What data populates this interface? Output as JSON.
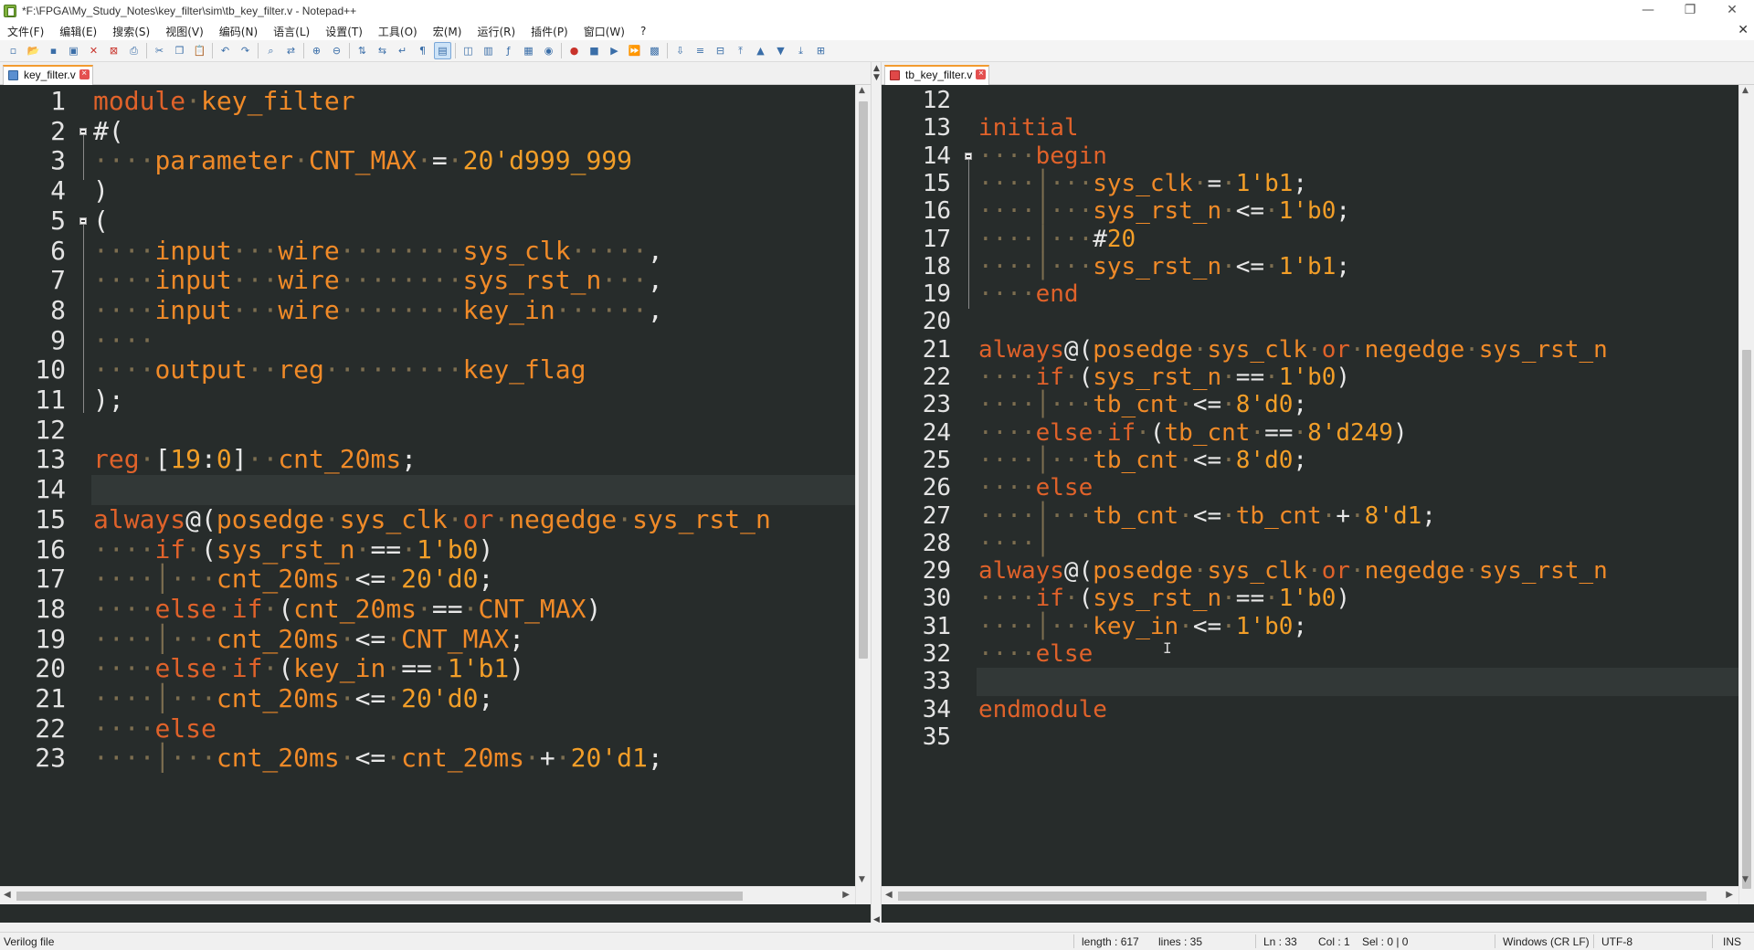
{
  "window": {
    "title": "*F:\\FPGA\\My_Study_Notes\\key_filter\\sim\\tb_key_filter.v - Notepad++",
    "minimize": "—",
    "restore": "❐",
    "close": "✕"
  },
  "menu": [
    "文件(F)",
    "编辑(E)",
    "搜索(S)",
    "视图(V)",
    "编码(N)",
    "语言(L)",
    "设置(T)",
    "工具(O)",
    "宏(M)",
    "运行(R)",
    "插件(P)",
    "窗口(W)",
    "?"
  ],
  "menu_close": "✕",
  "toolbar_icons": [
    "new-file-icon",
    "open-file-icon",
    "save-icon",
    "save-all-icon",
    "close-icon",
    "close-all-icon",
    "print-icon",
    "sep",
    "cut-icon",
    "copy-icon",
    "paste-icon",
    "sep",
    "undo-icon",
    "redo-icon",
    "sep",
    "find-icon",
    "replace-icon",
    "sep",
    "zoom-in-icon",
    "zoom-out-icon",
    "sep",
    "sync-vertical-icon",
    "sync-horizontal-icon",
    "word-wrap-icon",
    "show-all-chars-icon",
    "indent-guide-icon",
    "sep",
    "udl-icon",
    "doc-map-icon",
    "function-list-icon",
    "folder-as-workspace-icon",
    "monitoring-icon",
    "sep",
    "record-macro-icon",
    "stop-record-icon",
    "play-macro-icon",
    "run-macro-multiple-icon",
    "save-macro-icon",
    "sep",
    "compare-icon",
    "diff-icon",
    "prev-diff-icon",
    "first-diff-icon",
    "prev-icon",
    "next-icon",
    "last-icon",
    "plugin-icon"
  ],
  "left_tab": {
    "label": "key_filter.v"
  },
  "right_tab": {
    "label": "tb_key_filter.v"
  },
  "left_lines": [
    {
      "n": "1",
      "t": [
        [
          "kw",
          "module"
        ],
        [
          "ws",
          "·"
        ],
        [
          "id",
          "key_filter"
        ]
      ]
    },
    {
      "n": "2",
      "fold": true,
      "t": [
        [
          "pl",
          "#("
        ]
      ]
    },
    {
      "n": "3",
      "t": [
        [
          "ws",
          "····"
        ],
        [
          "id",
          "parameter"
        ],
        [
          "ws",
          "·"
        ],
        [
          "id",
          "CNT_MAX"
        ],
        [
          "ws",
          "·"
        ],
        [
          "pl",
          "="
        ],
        [
          "ws",
          "·"
        ],
        [
          "num",
          "20'd999_999"
        ]
      ]
    },
    {
      "n": "4",
      "t": [
        [
          "pl",
          ")"
        ]
      ]
    },
    {
      "n": "5",
      "fold": true,
      "t": [
        [
          "pl",
          "("
        ]
      ]
    },
    {
      "n": "6",
      "t": [
        [
          "ws",
          "····"
        ],
        [
          "id",
          "input"
        ],
        [
          "ws",
          "···"
        ],
        [
          "id",
          "wire"
        ],
        [
          "ws",
          "········"
        ],
        [
          "id",
          "sys_clk"
        ],
        [
          "ws",
          "·····"
        ],
        [
          "pl",
          ","
        ]
      ]
    },
    {
      "n": "7",
      "t": [
        [
          "ws",
          "····"
        ],
        [
          "id",
          "input"
        ],
        [
          "ws",
          "···"
        ],
        [
          "id",
          "wire"
        ],
        [
          "ws",
          "········"
        ],
        [
          "id",
          "sys_rst_n"
        ],
        [
          "ws",
          "···"
        ],
        [
          "pl",
          ","
        ]
      ]
    },
    {
      "n": "8",
      "t": [
        [
          "ws",
          "····"
        ],
        [
          "id",
          "input"
        ],
        [
          "ws",
          "···"
        ],
        [
          "id",
          "wire"
        ],
        [
          "ws",
          "········"
        ],
        [
          "id",
          "key_in"
        ],
        [
          "ws",
          "······"
        ],
        [
          "pl",
          ","
        ]
      ]
    },
    {
      "n": "9",
      "t": [
        [
          "ws",
          "····"
        ]
      ]
    },
    {
      "n": "10",
      "t": [
        [
          "ws",
          "····"
        ],
        [
          "id",
          "output"
        ],
        [
          "ws",
          "··"
        ],
        [
          "id",
          "reg"
        ],
        [
          "ws",
          "·········"
        ],
        [
          "id",
          "key_flag"
        ]
      ]
    },
    {
      "n": "11",
      "t": [
        [
          "pl",
          ");"
        ]
      ]
    },
    {
      "n": "12",
      "t": []
    },
    {
      "n": "13",
      "t": [
        [
          "kw",
          "reg"
        ],
        [
          "ws",
          "·"
        ],
        [
          "pl",
          "["
        ],
        [
          "num",
          "19"
        ],
        [
          "pl",
          ":"
        ],
        [
          "num",
          "0"
        ],
        [
          "pl",
          "]"
        ],
        [
          "ws",
          "··"
        ],
        [
          "id",
          "cnt_20ms"
        ],
        [
          "pl",
          ";"
        ]
      ]
    },
    {
      "n": "14",
      "cur": true,
      "t": []
    },
    {
      "n": "15",
      "t": [
        [
          "kw",
          "always"
        ],
        [
          "pl",
          "@("
        ],
        [
          "id",
          "posedge"
        ],
        [
          "ws",
          "·"
        ],
        [
          "id",
          "sys_clk"
        ],
        [
          "ws",
          "·"
        ],
        [
          "kw",
          "or"
        ],
        [
          "ws",
          "·"
        ],
        [
          "id",
          "negedge"
        ],
        [
          "ws",
          "·"
        ],
        [
          "id",
          "sys_rst_n"
        ]
      ]
    },
    {
      "n": "16",
      "t": [
        [
          "ws",
          "····"
        ],
        [
          "kw",
          "if"
        ],
        [
          "ws",
          "·"
        ],
        [
          "pl",
          "("
        ],
        [
          "id",
          "sys_rst_n"
        ],
        [
          "ws",
          "·"
        ],
        [
          "pl",
          "=="
        ],
        [
          "ws",
          "·"
        ],
        [
          "num",
          "1'b0"
        ],
        [
          "pl",
          ")"
        ]
      ]
    },
    {
      "n": "17",
      "t": [
        [
          "ws",
          "····│···"
        ],
        [
          "id",
          "cnt_20ms"
        ],
        [
          "ws",
          "·"
        ],
        [
          "pl",
          "<="
        ],
        [
          "ws",
          "·"
        ],
        [
          "num",
          "20'd0"
        ],
        [
          "pl",
          ";"
        ]
      ]
    },
    {
      "n": "18",
      "t": [
        [
          "ws",
          "····"
        ],
        [
          "kw",
          "else"
        ],
        [
          "ws",
          "·"
        ],
        [
          "kw",
          "if"
        ],
        [
          "ws",
          "·"
        ],
        [
          "pl",
          "("
        ],
        [
          "id",
          "cnt_20ms"
        ],
        [
          "ws",
          "·"
        ],
        [
          "pl",
          "=="
        ],
        [
          "ws",
          "·"
        ],
        [
          "id",
          "CNT_MAX"
        ],
        [
          "pl",
          ")"
        ]
      ]
    },
    {
      "n": "19",
      "t": [
        [
          "ws",
          "····│···"
        ],
        [
          "id",
          "cnt_20ms"
        ],
        [
          "ws",
          "·"
        ],
        [
          "pl",
          "<="
        ],
        [
          "ws",
          "·"
        ],
        [
          "id",
          "CNT_MAX"
        ],
        [
          "pl",
          ";"
        ]
      ]
    },
    {
      "n": "20",
      "t": [
        [
          "ws",
          "····"
        ],
        [
          "kw",
          "else"
        ],
        [
          "ws",
          "·"
        ],
        [
          "kw",
          "if"
        ],
        [
          "ws",
          "·"
        ],
        [
          "pl",
          "("
        ],
        [
          "id",
          "key_in"
        ],
        [
          "ws",
          "·"
        ],
        [
          "pl",
          "=="
        ],
        [
          "ws",
          "·"
        ],
        [
          "num",
          "1'b1"
        ],
        [
          "pl",
          ")"
        ]
      ]
    },
    {
      "n": "21",
      "t": [
        [
          "ws",
          "····│···"
        ],
        [
          "id",
          "cnt_20ms"
        ],
        [
          "ws",
          "·"
        ],
        [
          "pl",
          "<="
        ],
        [
          "ws",
          "·"
        ],
        [
          "num",
          "20'd0"
        ],
        [
          "pl",
          ";"
        ]
      ]
    },
    {
      "n": "22",
      "t": [
        [
          "ws",
          "····"
        ],
        [
          "kw",
          "else"
        ]
      ]
    },
    {
      "n": "23",
      "t": [
        [
          "ws",
          "····│···"
        ],
        [
          "id",
          "cnt_20ms"
        ],
        [
          "ws",
          "·"
        ],
        [
          "pl",
          "<="
        ],
        [
          "ws",
          "·"
        ],
        [
          "id",
          "cnt_20ms"
        ],
        [
          "ws",
          "·"
        ],
        [
          "pl",
          "+"
        ],
        [
          "ws",
          "·"
        ],
        [
          "num",
          "20'd1"
        ],
        [
          "pl",
          ";"
        ]
      ]
    }
  ],
  "right_lines": [
    {
      "n": "12",
      "t": []
    },
    {
      "n": "13",
      "t": [
        [
          "kw",
          "initial"
        ]
      ]
    },
    {
      "n": "14",
      "fold": true,
      "t": [
        [
          "ws",
          "····"
        ],
        [
          "kw",
          "begin"
        ]
      ]
    },
    {
      "n": "15",
      "t": [
        [
          "ws",
          "····│···"
        ],
        [
          "id",
          "sys_clk"
        ],
        [
          "ws",
          "·"
        ],
        [
          "pl",
          "="
        ],
        [
          "ws",
          "·"
        ],
        [
          "num",
          "1'b1"
        ],
        [
          "pl",
          ";"
        ]
      ]
    },
    {
      "n": "16",
      "t": [
        [
          "ws",
          "····│···"
        ],
        [
          "id",
          "sys_rst_n"
        ],
        [
          "ws",
          "·"
        ],
        [
          "pl",
          "<="
        ],
        [
          "ws",
          "·"
        ],
        [
          "num",
          "1'b0"
        ],
        [
          "pl",
          ";"
        ]
      ]
    },
    {
      "n": "17",
      "t": [
        [
          "ws",
          "····│···"
        ],
        [
          "pl",
          "#"
        ],
        [
          "num",
          "20"
        ]
      ]
    },
    {
      "n": "18",
      "t": [
        [
          "ws",
          "····│···"
        ],
        [
          "id",
          "sys_rst_n"
        ],
        [
          "ws",
          "·"
        ],
        [
          "pl",
          "<="
        ],
        [
          "ws",
          "·"
        ],
        [
          "num",
          "1'b1"
        ],
        [
          "pl",
          ";"
        ]
      ]
    },
    {
      "n": "19",
      "t": [
        [
          "ws",
          "····"
        ],
        [
          "kw",
          "end"
        ]
      ]
    },
    {
      "n": "20",
      "t": []
    },
    {
      "n": "21",
      "t": [
        [
          "kw",
          "always"
        ],
        [
          "pl",
          "@("
        ],
        [
          "id",
          "posedge"
        ],
        [
          "ws",
          "·"
        ],
        [
          "id",
          "sys_clk"
        ],
        [
          "ws",
          "·"
        ],
        [
          "kw",
          "or"
        ],
        [
          "ws",
          "·"
        ],
        [
          "id",
          "negedge"
        ],
        [
          "ws",
          "·"
        ],
        [
          "id",
          "sys_rst_n"
        ]
      ]
    },
    {
      "n": "22",
      "t": [
        [
          "ws",
          "····"
        ],
        [
          "kw",
          "if"
        ],
        [
          "ws",
          "·"
        ],
        [
          "pl",
          "("
        ],
        [
          "id",
          "sys_rst_n"
        ],
        [
          "ws",
          "·"
        ],
        [
          "pl",
          "=="
        ],
        [
          "ws",
          "·"
        ],
        [
          "num",
          "1'b0"
        ],
        [
          "pl",
          ")"
        ]
      ]
    },
    {
      "n": "23",
      "t": [
        [
          "ws",
          "····│···"
        ],
        [
          "id",
          "tb_cnt"
        ],
        [
          "ws",
          "·"
        ],
        [
          "pl",
          "<="
        ],
        [
          "ws",
          "·"
        ],
        [
          "num",
          "8'd0"
        ],
        [
          "pl",
          ";"
        ]
      ]
    },
    {
      "n": "24",
      "t": [
        [
          "ws",
          "····"
        ],
        [
          "kw",
          "else"
        ],
        [
          "ws",
          "·"
        ],
        [
          "kw",
          "if"
        ],
        [
          "ws",
          "·"
        ],
        [
          "pl",
          "("
        ],
        [
          "id",
          "tb_cnt"
        ],
        [
          "ws",
          "·"
        ],
        [
          "pl",
          "=="
        ],
        [
          "ws",
          "·"
        ],
        [
          "num",
          "8'd249"
        ],
        [
          "pl",
          ")"
        ]
      ]
    },
    {
      "n": "25",
      "t": [
        [
          "ws",
          "····│···"
        ],
        [
          "id",
          "tb_cnt"
        ],
        [
          "ws",
          "·"
        ],
        [
          "pl",
          "<="
        ],
        [
          "ws",
          "·"
        ],
        [
          "num",
          "8'd0"
        ],
        [
          "pl",
          ";"
        ]
      ]
    },
    {
      "n": "26",
      "t": [
        [
          "ws",
          "····"
        ],
        [
          "kw",
          "else"
        ]
      ]
    },
    {
      "n": "27",
      "t": [
        [
          "ws",
          "····│···"
        ],
        [
          "id",
          "tb_cnt"
        ],
        [
          "ws",
          "·"
        ],
        [
          "pl",
          "<="
        ],
        [
          "ws",
          "·"
        ],
        [
          "id",
          "tb_cnt"
        ],
        [
          "ws",
          "·"
        ],
        [
          "pl",
          "+"
        ],
        [
          "ws",
          "·"
        ],
        [
          "num",
          "8'd1"
        ],
        [
          "pl",
          ";"
        ]
      ]
    },
    {
      "n": "28",
      "t": [
        [
          "ws",
          "····│"
        ]
      ]
    },
    {
      "n": "29",
      "t": [
        [
          "kw",
          "always"
        ],
        [
          "pl",
          "@("
        ],
        [
          "id",
          "posedge"
        ],
        [
          "ws",
          "·"
        ],
        [
          "id",
          "sys_clk"
        ],
        [
          "ws",
          "·"
        ],
        [
          "kw",
          "or"
        ],
        [
          "ws",
          "·"
        ],
        [
          "id",
          "negedge"
        ],
        [
          "ws",
          "·"
        ],
        [
          "id",
          "sys_rst_n"
        ]
      ]
    },
    {
      "n": "30",
      "t": [
        [
          "ws",
          "····"
        ],
        [
          "kw",
          "if"
        ],
        [
          "ws",
          "·"
        ],
        [
          "pl",
          "("
        ],
        [
          "id",
          "sys_rst_n"
        ],
        [
          "ws",
          "·"
        ],
        [
          "pl",
          "=="
        ],
        [
          "ws",
          "·"
        ],
        [
          "num",
          "1'b0"
        ],
        [
          "pl",
          ")"
        ]
      ]
    },
    {
      "n": "31",
      "t": [
        [
          "ws",
          "····│···"
        ],
        [
          "id",
          "key_in"
        ],
        [
          "ws",
          "·"
        ],
        [
          "pl",
          "<="
        ],
        [
          "ws",
          "·"
        ],
        [
          "num",
          "1'b0"
        ],
        [
          "pl",
          ";"
        ]
      ]
    },
    {
      "n": "32",
      "t": [
        [
          "ws",
          "····"
        ],
        [
          "kw",
          "else"
        ]
      ]
    },
    {
      "n": "33",
      "cur": true,
      "t": []
    },
    {
      "n": "34",
      "t": [
        [
          "kw",
          "endmodule"
        ]
      ]
    },
    {
      "n": "35",
      "t": []
    }
  ],
  "status": {
    "filetype": "Verilog file",
    "length": "length : 617",
    "lines": "lines : 35",
    "ln": "Ln : 33",
    "col": "Col : 1",
    "sel": "Sel : 0 | 0",
    "eol": "Windows (CR LF)",
    "encoding": "UTF-8",
    "mode": "INS"
  },
  "colors": {
    "editor_bg": "#272c2b",
    "keyword": "#e0622a",
    "identifier": "#f08a28",
    "number": "#f29e28",
    "whitespace": "#7d6e50",
    "tab_accent": "#f29b30"
  }
}
